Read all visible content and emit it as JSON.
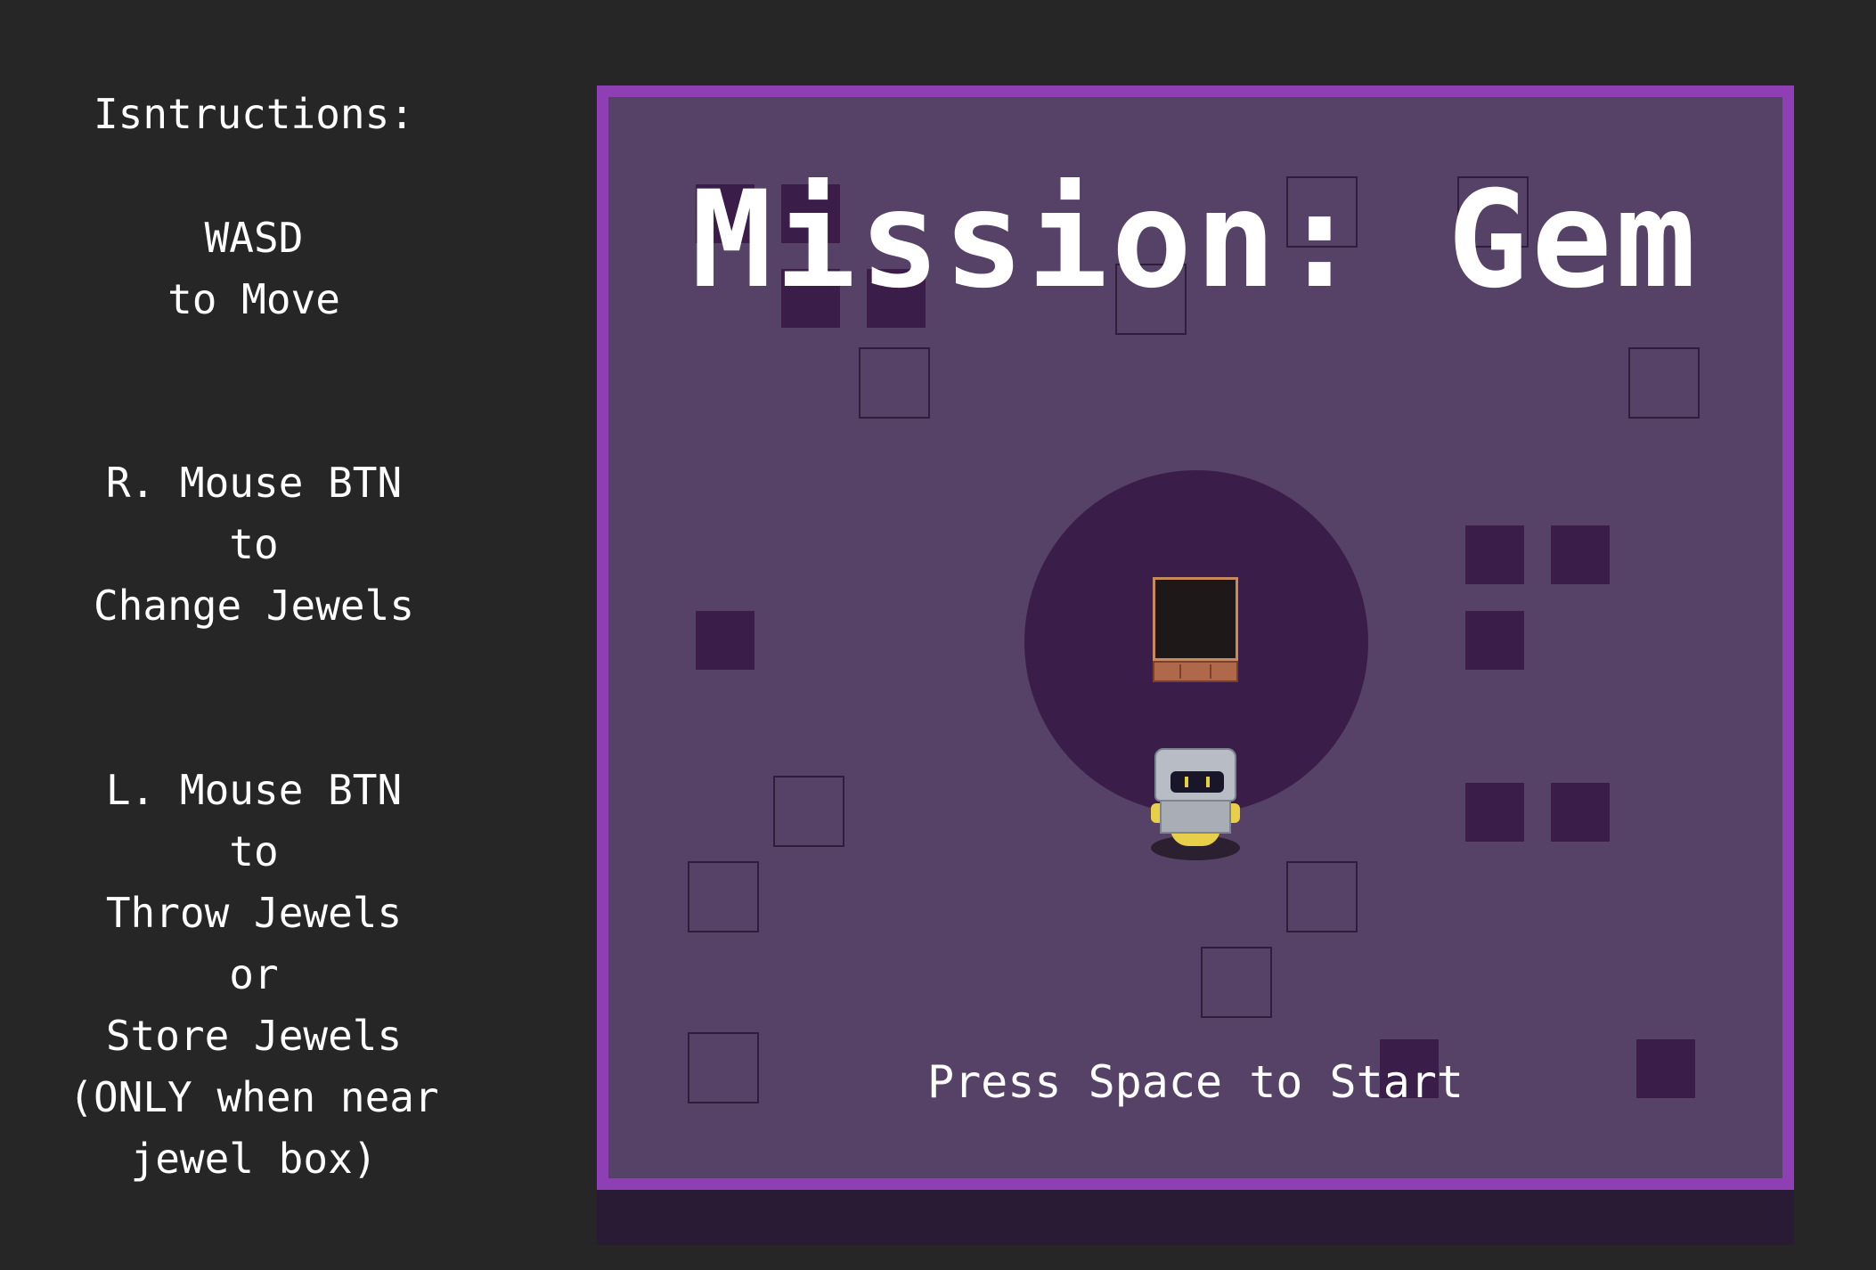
{
  "instructions": {
    "heading": "Isntructions:",
    "move_line1": "WASD",
    "move_line2": "to Move",
    "change_line1": "R. Mouse BTN",
    "change_line2": "to",
    "change_line3": "Change Jewels",
    "throw_line1": "L. Mouse BTN",
    "throw_line2": "to",
    "throw_line3": "Throw Jewels",
    "throw_line4": "or",
    "throw_line5": "Store Jewels",
    "throw_line6": "(ONLY when near",
    "throw_line7": "jewel box)"
  },
  "game": {
    "title": "Mission: Gem",
    "prompt": "Press Space to Start"
  },
  "colors": {
    "background": "#262626",
    "frame": "#8e3fb3",
    "floor": "#554266",
    "dark_tile": "#3b1d4a"
  },
  "icons": {
    "player": "robot-sprite",
    "jewel_box": "jewel-box-sprite"
  }
}
